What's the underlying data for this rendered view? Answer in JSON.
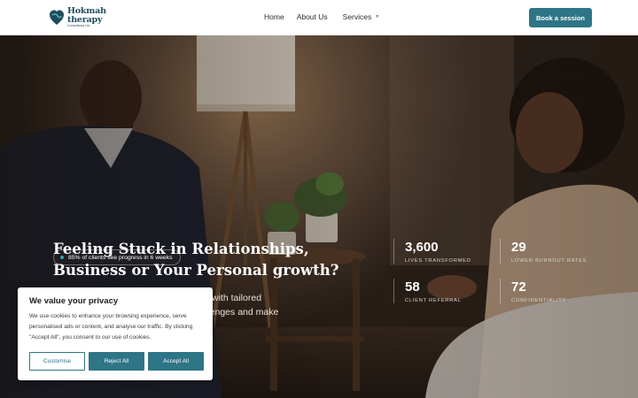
{
  "header": {
    "logo": {
      "line1": "Hokmah",
      "line2": "therapy",
      "line3": "Consultancy Ltd"
    },
    "nav": [
      {
        "label": "Home"
      },
      {
        "label": "About Us"
      },
      {
        "label": "Services"
      }
    ],
    "cta_label": "Book a session"
  },
  "hero": {
    "badge": "85% of clients see progress in 6 weeks",
    "headline": "Feeling Stuck in Relationships, Business or Your Personal growth?",
    "subtext_line1": "with tailored",
    "subtext_line2": "llenges and make",
    "stats": [
      {
        "value": "3,600",
        "label": "LIVES TRANSFORMED"
      },
      {
        "value": "29",
        "label": "LOWER BURNOUT RATES"
      },
      {
        "value": "58",
        "label": "CLIENT REFERRAL"
      },
      {
        "value": "72",
        "label": "CONFIDENTIALITY"
      }
    ]
  },
  "cookie": {
    "title": "We value your privacy",
    "text": "We use cookies to enhance your browsing experience, serve personalised ads or content, and analyse our traffic. By clicking \"Accept All\", you consent to our use of cookies.",
    "customise": "Customise",
    "reject": "Reject All",
    "accept": "Accept All"
  },
  "colors": {
    "accent": "#2e7586",
    "brand": "#1f4b5e"
  }
}
